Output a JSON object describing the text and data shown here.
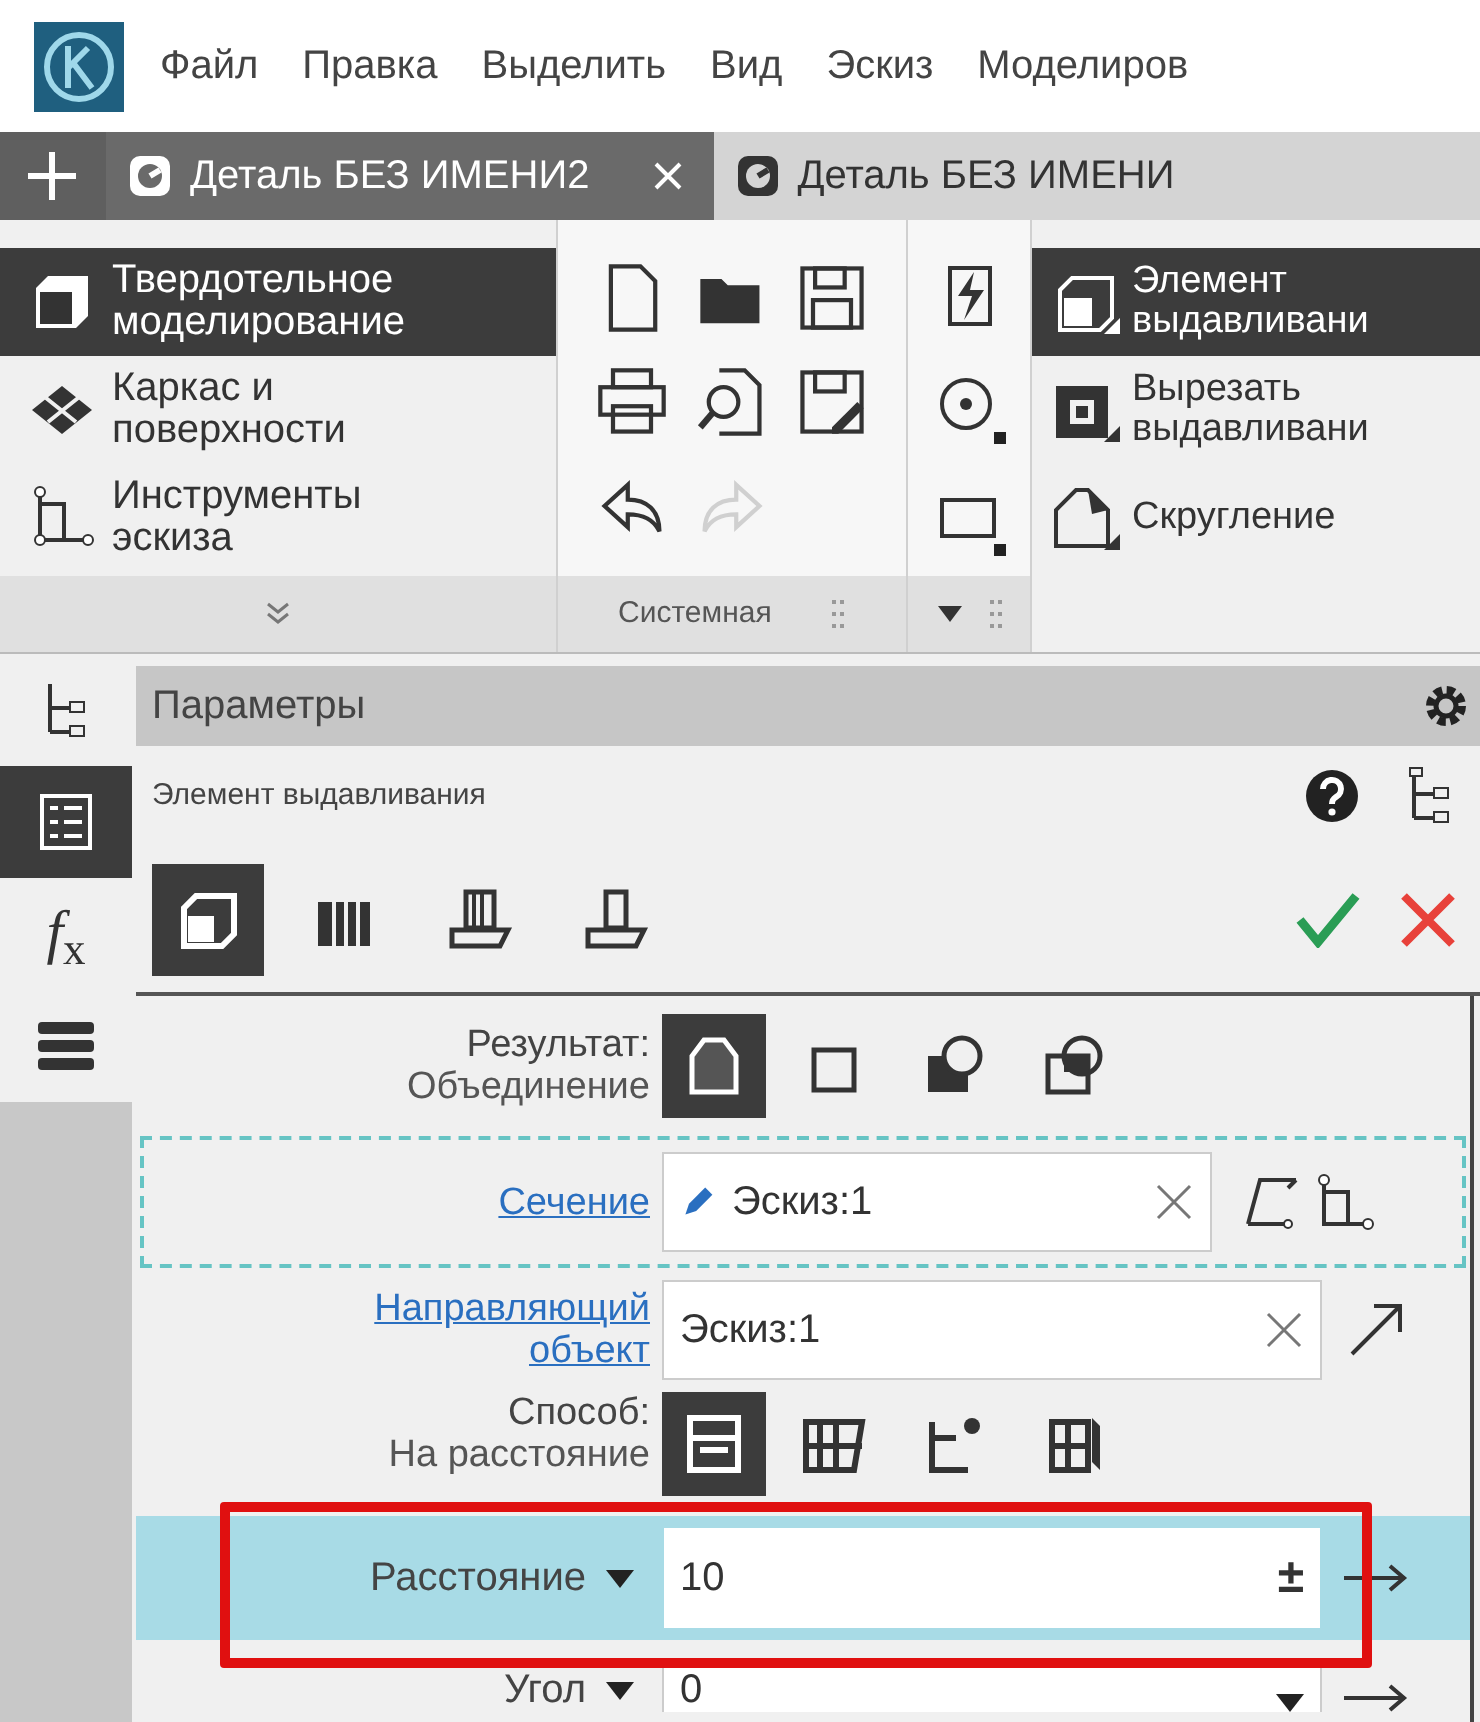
{
  "menu": [
    "Файл",
    "Правка",
    "Выделить",
    "Вид",
    "Эскиз",
    "Моделиров"
  ],
  "tabs": [
    {
      "label": "Деталь БЕЗ ИМЕНИ2",
      "selected": true
    },
    {
      "label": "Деталь БЕЗ ИМЕНИ",
      "selected": false
    }
  ],
  "ribbon": {
    "categories": [
      {
        "label": "Твердотельное моделирование",
        "selected": true
      },
      {
        "label": "Каркас и поверхности",
        "selected": false
      },
      {
        "label": "Инструменты эскиза",
        "selected": false
      }
    ],
    "system_group": {
      "label": "Системная",
      "buttons": [
        {
          "disabled": false
        },
        {
          "disabled": false
        },
        {
          "disabled": false
        },
        {
          "disabled": false
        },
        {
          "disabled": false
        },
        {
          "disabled": false
        },
        {
          "disabled": false
        },
        {
          "disabled": true
        }
      ]
    },
    "commands": [
      {
        "label": "Элемент выдавливани",
        "selected": true
      },
      {
        "label": "Вырезать выдавливани",
        "selected": false
      },
      {
        "label": "Скругление",
        "selected": false
      }
    ]
  },
  "side_tabs": [
    {
      "selected": false
    },
    {
      "selected": true
    },
    {
      "selected": false,
      "text": "*f*$_{x}$"
    },
    {
      "selected": false
    }
  ],
  "panel": {
    "title": "Параметры",
    "subtitle": "Элемент выдавливания",
    "modes": [
      {
        "selected": true
      },
      {
        "selected": false
      },
      {
        "selected": false
      },
      {
        "selected": false
      }
    ],
    "result": {
      "label": "Результат:",
      "value": "Объединение",
      "options": [
        {
          "selected": true
        },
        {
          "selected": false
        },
        {
          "selected": false
        },
        {
          "selected": false
        }
      ]
    },
    "section": {
      "label": "Сечение",
      "value": "Эскиз:1"
    },
    "guide": {
      "label": "Направляющий объект",
      "value": "Эскиз:1"
    },
    "method": {
      "label": "Способ:",
      "value": "На расстояние",
      "options": [
        {
          "selected": true
        },
        {
          "selected": false
        },
        {
          "selected": false
        },
        {
          "selected": false
        }
      ]
    },
    "distance": {
      "label": "Расстояние",
      "value": "10",
      "sign": "±"
    },
    "angle": {
      "label": "Угол",
      "value": "0"
    }
  }
}
